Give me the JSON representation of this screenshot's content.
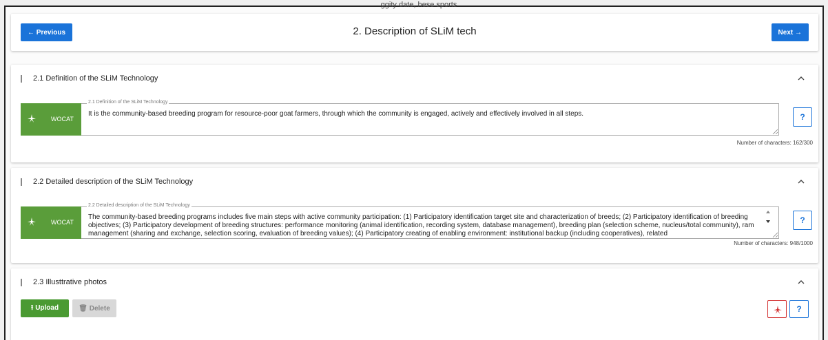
{
  "window": {
    "partial_caption": "ggity date, hese sports"
  },
  "header": {
    "previous_label": "← Previous",
    "title": "2. Description of SLiM tech",
    "next_label": "Next →"
  },
  "sections": [
    {
      "title": "2.1 Definition of the SLiM Technology",
      "badge_label": "WOCAT",
      "field_legend": "2.1 Definition of the SLiM Technology",
      "field_value": "It is the community-based breeding program for resource-poor goat farmers, through which the community is engaged, actively and effectively involved in all steps.",
      "help_label": "?",
      "char_count": "Number of characters: 162/300"
    },
    {
      "title": "2.2 Detailed description of the SLiM Technology",
      "badge_label": "WOCAT",
      "field_legend": "2.2 Detailed description of the SLiM Technology",
      "field_value": "The community-based breeding programs includes five main steps with active community participation: (1) Participatory identification target site and characterization of breeds; (2) Participatory identification of breeding objectives; (3) Participatory development of breeding structures: performance monitoring (animal identification, recording system, database management), breeding plan (selection scheme, nucleus/total community), ram management (sharing and exchange, selection scoring, evaluation of breeding values); (4) Participatory creating of enabling environment: institutional backup (including cooperatives), related",
      "help_label": "?",
      "char_count": "Number of characters: 948/1000"
    },
    {
      "title": "2.3 Illusttrative photos",
      "upload_label": "Upload",
      "delete_label": "Delete",
      "help_label": "?"
    }
  ],
  "colors": {
    "primary_blue": "#1a73d9",
    "wocat_green": "#5a9d3a",
    "upload_green": "#4a9a32",
    "pdf_red": "#d32f2f"
  }
}
